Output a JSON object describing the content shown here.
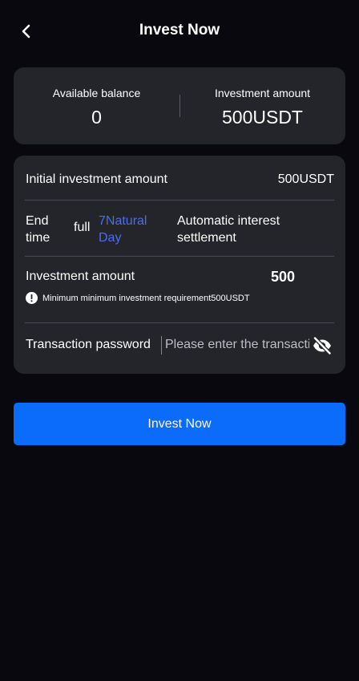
{
  "header": {
    "title": "Invest Now",
    "back_icon": "chevron-left-icon"
  },
  "balance": {
    "available_label": "Available balance",
    "available_value": "0",
    "investment_label": "Investment amount",
    "investment_value": "500USDT"
  },
  "details": {
    "initial_label": "Initial investment amount",
    "initial_value": "500USDT",
    "end_time_label": "End time",
    "end_time_full": "full",
    "end_time_period": "7Natural Day",
    "settlement": "Automatic interest settlement",
    "amount_label": "Investment amount",
    "amount_value": "500",
    "warning_icon": "info-icon",
    "minimum_note": "Minimum minimum investment requirement500USDT",
    "password_label": "Transaction password",
    "password_placeholder": "Please enter the transaction password",
    "password_value": "",
    "visibility_icon": "eye-off-icon"
  },
  "actions": {
    "invest_button": "Invest Now"
  },
  "colors": {
    "background": "#08080e",
    "card": "#24242b",
    "accent": "#0b6bfb",
    "link": "#4a6fe8"
  }
}
